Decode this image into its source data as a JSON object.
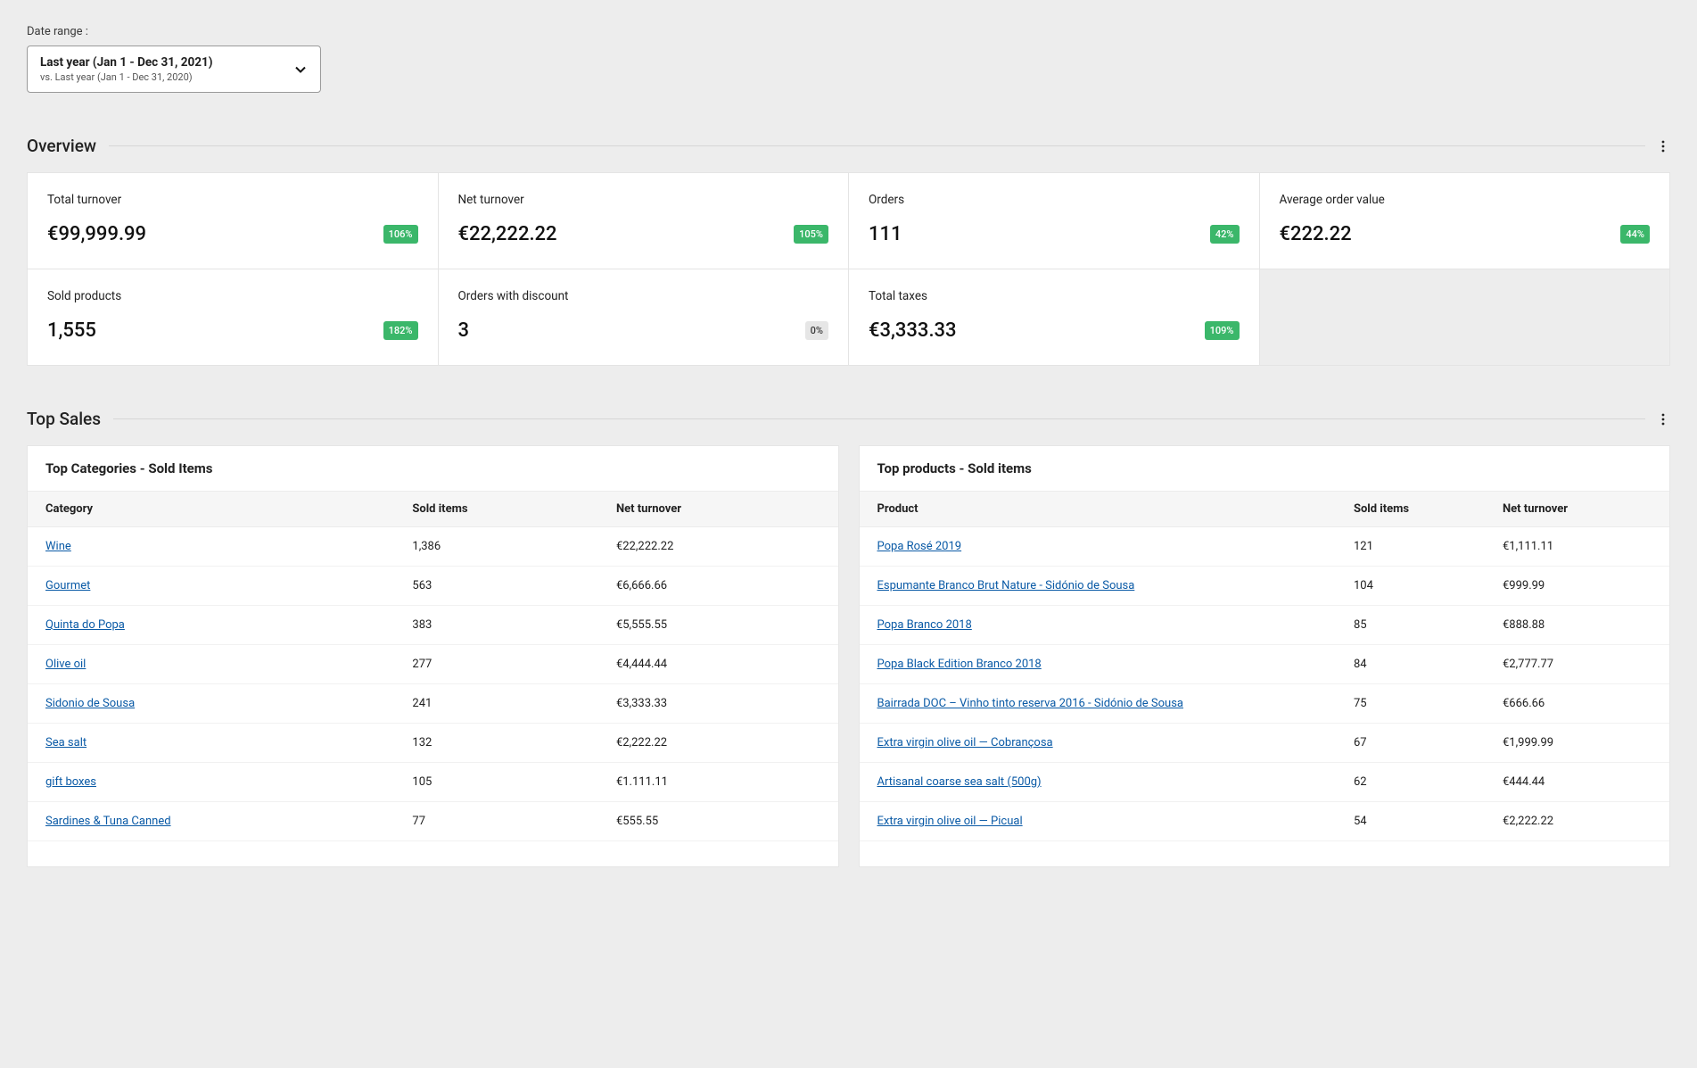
{
  "date_range": {
    "label": "Date range :",
    "primary": "Last year (Jan 1 - Dec 31, 2021)",
    "secondary": "vs. Last year (Jan 1 - Dec 31, 2020)"
  },
  "overview": {
    "title": "Overview",
    "cards": [
      {
        "label": "Total turnover",
        "value": "€99,999.99",
        "badge": "106%",
        "badge_style": "green"
      },
      {
        "label": "Net turnover",
        "value": "€22,222.22",
        "badge": "105%",
        "badge_style": "green"
      },
      {
        "label": "Orders",
        "value": "111",
        "badge": "42%",
        "badge_style": "green"
      },
      {
        "label": "Average order value",
        "value": "€222.22",
        "badge": "44%",
        "badge_style": "green"
      },
      {
        "label": "Sold products",
        "value": "1,555",
        "badge": "182%",
        "badge_style": "green"
      },
      {
        "label": "Orders with discount",
        "value": "3",
        "badge": "0%",
        "badge_style": "gray"
      },
      {
        "label": "Total taxes",
        "value": "€3,333.33",
        "badge": "109%",
        "badge_style": "green"
      }
    ]
  },
  "top_sales": {
    "title": "Top Sales",
    "categories": {
      "title": "Top Categories - Sold Items",
      "headers": {
        "c0": "Category",
        "c1": "Sold items",
        "c2": "Net turnover"
      },
      "rows": [
        {
          "name": "Wine",
          "sold": "1,386",
          "net": "€22,222.22"
        },
        {
          "name": "Gourmet",
          "sold": "563",
          "net": "€6,666.66"
        },
        {
          "name": "Quinta do Popa",
          "sold": "383",
          "net": "€5,555.55"
        },
        {
          "name": "Olive oil",
          "sold": "277",
          "net": "€4,444.44"
        },
        {
          "name": "Sidonio de Sousa",
          "sold": "241",
          "net": "€3,333.33"
        },
        {
          "name": "Sea salt",
          "sold": "132",
          "net": "€2,222.22"
        },
        {
          "name": "gift boxes",
          "sold": "105",
          "net": "€1.111.11"
        },
        {
          "name": "Sardines & Tuna Canned",
          "sold": "77",
          "net": "€555.55"
        }
      ]
    },
    "products": {
      "title": "Top products - Sold items",
      "headers": {
        "c0": "Product",
        "c1": "Sold items",
        "c2": "Net turnover"
      },
      "rows": [
        {
          "name": "Popa Rosé 2019",
          "sold": "121",
          "net": "€1,111.11"
        },
        {
          "name": "Espumante Branco Brut Nature - Sidónio de Sousa",
          "sold": "104",
          "net": "€999.99"
        },
        {
          "name": "Popa Branco 2018",
          "sold": "85",
          "net": "€888.88"
        },
        {
          "name": "Popa Black Edition Branco 2018",
          "sold": "84",
          "net": "€2,777.77"
        },
        {
          "name": "Bairrada DOC – Vinho tinto reserva 2016 - Sidónio de Sousa",
          "sold": "75",
          "net": "€666.66"
        },
        {
          "name": "Extra virgin olive oil — Cobrançosa",
          "sold": "67",
          "net": "€1,999.99"
        },
        {
          "name": "Artisanal coarse sea salt (500g)",
          "sold": "62",
          "net": "€444.44"
        },
        {
          "name": "Extra virgin olive oil — Picual",
          "sold": "54",
          "net": "€2,222.22"
        }
      ]
    }
  }
}
